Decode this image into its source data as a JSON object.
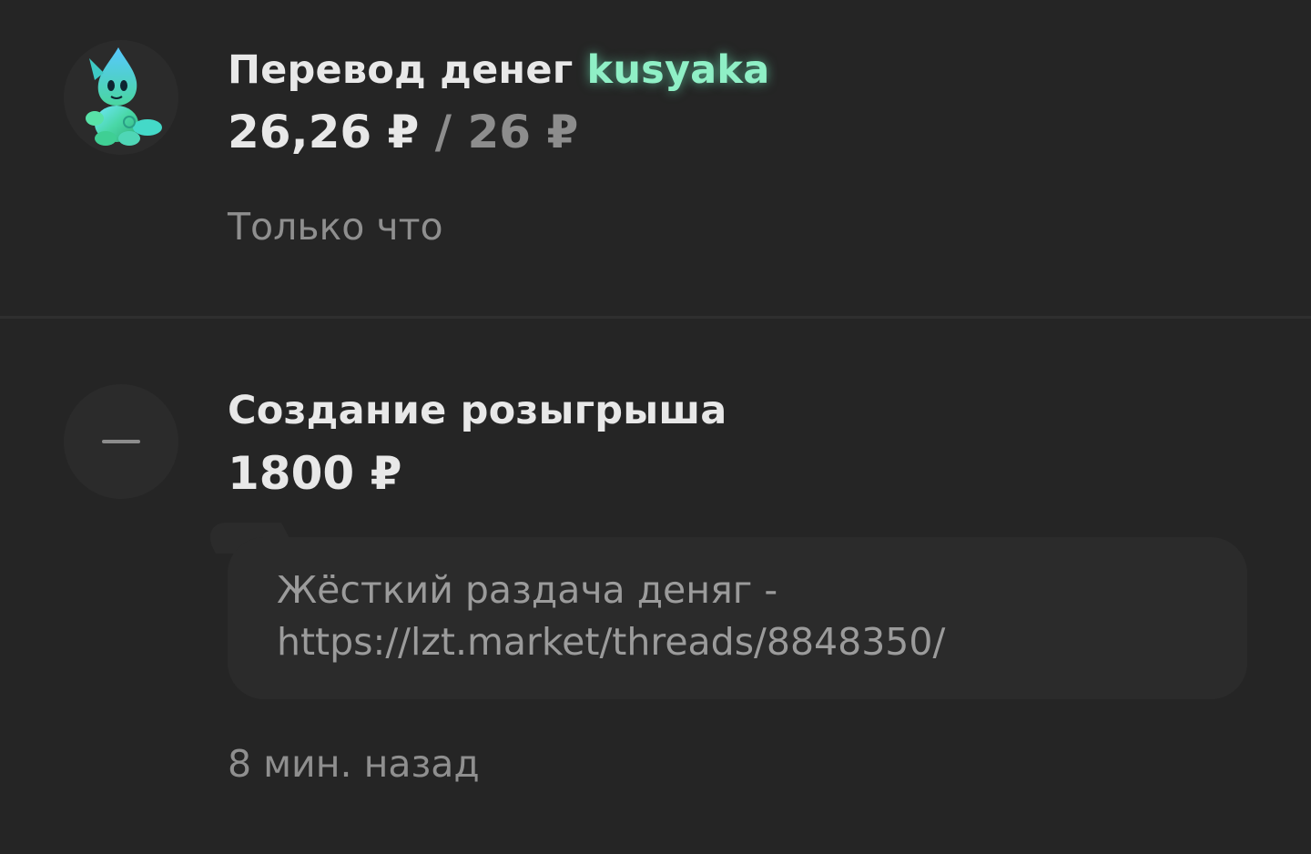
{
  "feed": {
    "items": [
      {
        "type": "transfer",
        "avatar_icon": "green-creature-avatar-icon",
        "title_prefix": "Перевод денег",
        "username": "kusyaka",
        "amount": "26,26 ₽",
        "separator": "/",
        "amount_secondary": "26 ₽",
        "time": "Только что"
      },
      {
        "type": "giveaway",
        "avatar_icon": "minus-icon",
        "title": "Создание розыгрыша",
        "amount": "1800 ₽",
        "comment_line1": "Жёсткий раздача деняг -",
        "comment_line2": "https://lzt.market/threads/8848350/",
        "time": "8 мин. назад"
      }
    ]
  },
  "colors": {
    "background": "#252525",
    "username_accent": "#8ff0c6",
    "muted_text": "#8f8f8f",
    "comment_bg": "#2b2b2b"
  }
}
